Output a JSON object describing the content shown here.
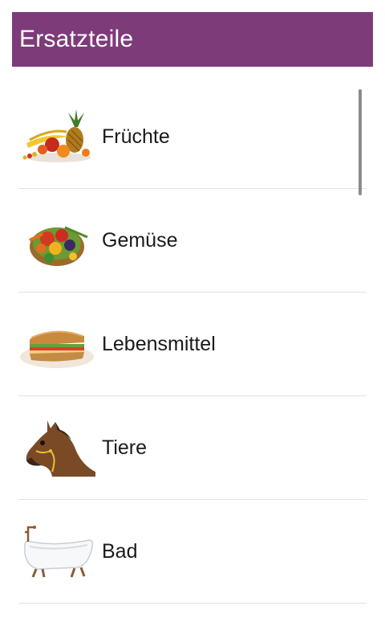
{
  "app": {
    "title": "Ersatzteile"
  },
  "colors": {
    "title_bar": "#7d3b7a",
    "divider": "#e3e3e3",
    "scrollbar": "#8c8c8c"
  },
  "list": {
    "items": [
      {
        "label": "Früchte",
        "icon": "fruits-icon"
      },
      {
        "label": "Gemüse",
        "icon": "vegetables-icon"
      },
      {
        "label": "Lebensmittel",
        "icon": "sandwich-icon"
      },
      {
        "label": "Tiere",
        "icon": "horse-icon"
      },
      {
        "label": "Bad",
        "icon": "bathtub-icon"
      }
    ]
  }
}
